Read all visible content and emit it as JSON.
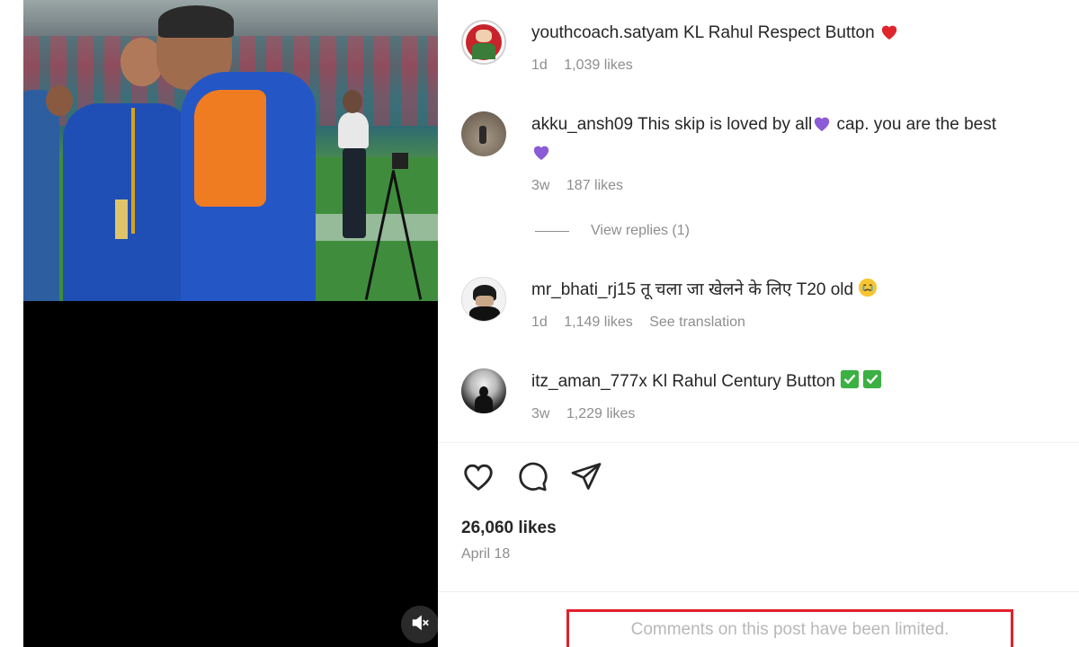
{
  "comments": [
    {
      "username": "youthcoach.satyam",
      "text": "KL Rahul Respect Button",
      "emoji": "red-heart",
      "time": "1d",
      "likes": "1,039 likes",
      "extra": ""
    },
    {
      "username": "akku_ansh09",
      "text_a": "This skip is loved by all",
      "text_b": " cap. you are the best",
      "emoji": "purple-heart",
      "time": "3w",
      "likes": "187 likes",
      "replies": "View replies (1)"
    },
    {
      "username": "mr_bhati_rj15",
      "text": "तू चला जा खेलने के लिए T20 old",
      "emoji": "crying-face",
      "time": "1d",
      "likes": "1,149 likes",
      "extra": "See translation"
    },
    {
      "username": "itz_aman_777x",
      "text": "Kl Rahul Century Button",
      "emoji": "check-boxes",
      "time": "3w",
      "likes": "1,229 likes",
      "extra": ""
    }
  ],
  "post": {
    "likes": "26,060 likes",
    "date": "April 18",
    "comments_notice": "Comments on this post have been limited."
  },
  "colors": {
    "highlight_border": "#e3202b",
    "meta_gray": "#8e8e8e"
  },
  "icons": [
    "heart-icon",
    "comment-icon",
    "share-icon",
    "muted-speaker-icon"
  ]
}
